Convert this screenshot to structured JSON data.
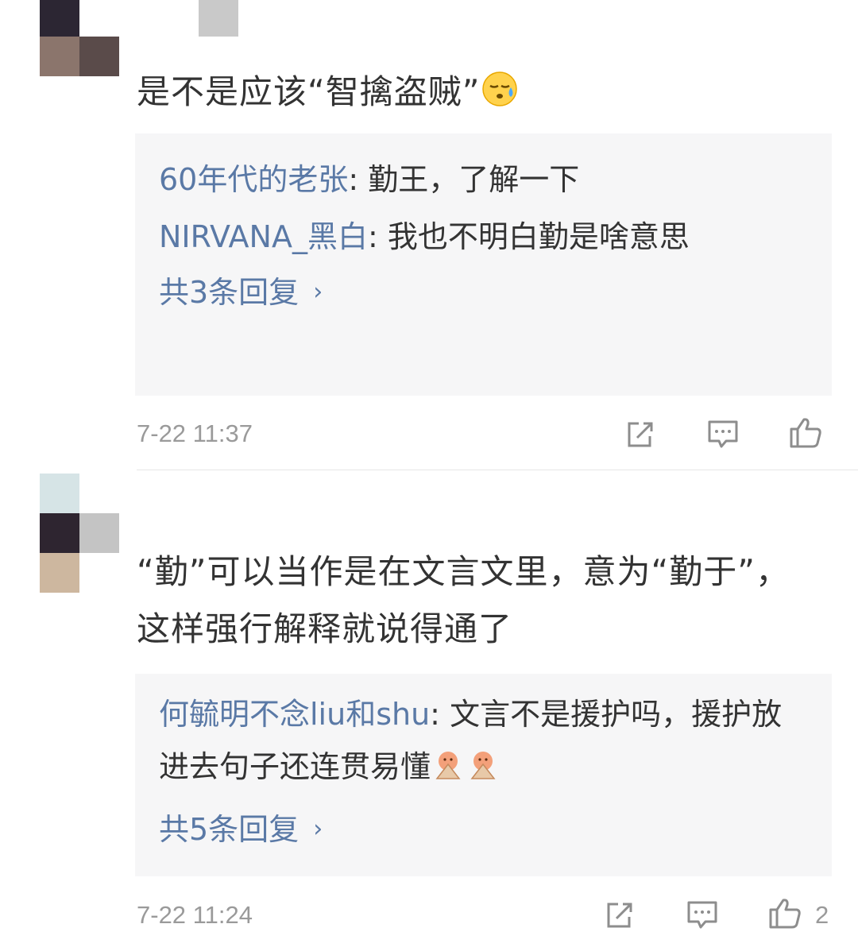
{
  "comments": [
    {
      "text": "是不是应该“智擒盗贼”",
      "emoji": "sweat-face-emoji",
      "replies": [
        {
          "user": "60年代的老张",
          "sep": ": ",
          "text": "勤王，了解一下"
        },
        {
          "user": "NIRVANA_黑白",
          "sep": ": ",
          "text": "我也不明白勤是啥意思"
        }
      ],
      "more_replies": "共3条回复",
      "time": "7-22 11:37",
      "likes": "",
      "avatar_colors": [
        "#2c2633",
        "#ffffff",
        "#8b756c",
        "#5a4b4a"
      ]
    },
    {
      "text": "“勤”可以当作是在文言文里，意为“勤于”，这样强行解释就说得通了",
      "replies": [
        {
          "user": "何毓明不念liu和shu",
          "sep": ": ",
          "text": "文言不是援护吗，援护放进去句子还连贯易懂"
        }
      ],
      "more_replies": "共5条回复",
      "time": "7-22 11:24",
      "likes": "2",
      "avatar_colors": [
        "#d6e4e6",
        "#ffffff",
        "#2e2530",
        "#c4c4c4",
        "#cdb79f",
        "#ffffff"
      ]
    }
  ],
  "icons": {
    "share": "share-icon",
    "comment": "comment-icon",
    "like": "thumbs-up-icon",
    "chevron": "›"
  },
  "colors": {
    "username": "#5a79a6",
    "reply_bg": "#f6f6f7",
    "meta": "#9a9a9a"
  }
}
